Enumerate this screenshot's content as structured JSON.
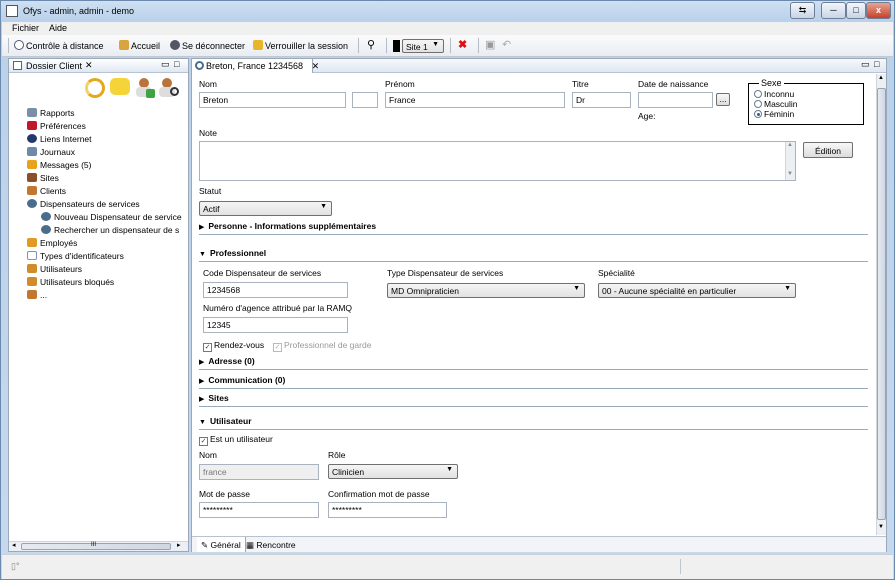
{
  "window": {
    "title": "Ofys - admin, admin - demo",
    "minimize": "─",
    "maximize": "□",
    "close": "x"
  },
  "menu": [
    "Fichier",
    "Aide"
  ],
  "toolbar": {
    "remote": "Contrôle à distance",
    "home": "Accueil",
    "logout": "Se déconnecter",
    "lock": "Verrouiller la session",
    "site": "Site 1"
  },
  "left_pane": {
    "title": "Dossier Client",
    "items": [
      {
        "label": "Rapports",
        "color": "#7a8fa8"
      },
      {
        "label": "Préférences",
        "color": "#c0182a"
      },
      {
        "label": "Liens Internet",
        "color": "#24386e"
      },
      {
        "label": "Journaux",
        "color": "#6f89a8"
      },
      {
        "label": "Messages (5)",
        "color": "#e9a21b"
      },
      {
        "label": "Sites",
        "color": "#8a4f28"
      },
      {
        "label": "Clients",
        "color": "#c2762f"
      },
      {
        "label": "Dispensateurs de services",
        "color": "#4a6d8c"
      },
      {
        "label": "Nouveau Dispensateur de service",
        "color": "#4a6d8c"
      },
      {
        "label": "Rechercher un dispensateur de s",
        "color": "#4a6d8c"
      },
      {
        "label": "Employés",
        "color": "#e19a24"
      },
      {
        "label": "Types d'identificateurs",
        "color": "#8793a2"
      },
      {
        "label": "Utilisateurs",
        "color": "#d08b2a"
      },
      {
        "label": "Utilisateurs bloqués",
        "color": "#d08b2a"
      },
      {
        "label": "...",
        "color": "#c2762f"
      }
    ],
    "hscroll_label": "III"
  },
  "editor": {
    "tab": "Breton, France 1234568",
    "labels": {
      "nom": "Nom",
      "prenom": "Prénom",
      "titre": "Titre",
      "naissance": "Date de naissance",
      "age": "Age:",
      "sexe": "Sexe",
      "note": "Note",
      "statut": "Statut"
    },
    "values": {
      "nom": "Breton",
      "initial": "",
      "prenom": "France",
      "titre": "Dr",
      "naissance": "",
      "browse": "..."
    },
    "sexe_options": [
      {
        "label": "Inconnu",
        "checked": false
      },
      {
        "label": "Masculin",
        "checked": false
      },
      {
        "label": "Féminin",
        "checked": true
      }
    ],
    "edition_button": "Édition",
    "statut": "Actif",
    "sections": {
      "personne": "Personne - Informations supplémentaires",
      "professionnel": "Professionnel",
      "adresse": "Adresse (0)",
      "communication": "Communication (0)",
      "sites": "Sites",
      "utilisateur": "Utilisateur"
    },
    "pro": {
      "code_label": "Code Dispensateur de services",
      "code": "1234568",
      "type_label": "Type Dispensateur de services",
      "type": "MD Omnipraticien",
      "spec_label": "Spécialité",
      "spec": "00 - Aucune spécialité en particulier",
      "agence_label": "Numéro d'agence attribué par la RAMQ",
      "agence": "12345",
      "rdv": "Rendez-vous",
      "garde": "Professionnel de garde"
    },
    "user": {
      "est_user": "Est un utilisateur",
      "nom_label": "Nom",
      "nom": "france",
      "role_label": "Rôle",
      "role": "Clinicien",
      "mdp_label": "Mot de passe",
      "mdp": "*********",
      "conf_label": "Confirmation mot de passe",
      "conf": "*********"
    },
    "bottom_tabs": [
      "Général",
      "Rencontre"
    ]
  }
}
